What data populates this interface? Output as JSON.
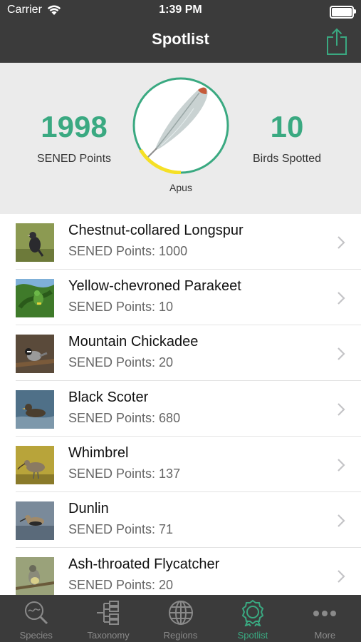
{
  "status_bar": {
    "carrier": "Carrier",
    "time": "1:39 PM"
  },
  "nav": {
    "title": "Spotlist"
  },
  "summary": {
    "points_value": "1998",
    "points_label": "SENED Points",
    "birds_value": "10",
    "birds_label": "Birds Spotted",
    "avatar_label": "Apus",
    "accent_color": "#3aa981"
  },
  "list": {
    "items": [
      {
        "name": "Chestnut-collared Longspur",
        "points": "SENED Points: 1000"
      },
      {
        "name": "Yellow-chevroned Parakeet",
        "points": "SENED Points: 10"
      },
      {
        "name": "Mountain Chickadee",
        "points": "SENED Points: 20"
      },
      {
        "name": "Black Scoter",
        "points": "SENED Points: 680"
      },
      {
        "name": "Whimbrel",
        "points": "SENED Points: 137"
      },
      {
        "name": "Dunlin",
        "points": "SENED Points: 71"
      },
      {
        "name": "Ash-throated Flycatcher",
        "points": "SENED Points: 20"
      }
    ]
  },
  "tabbar": {
    "tabs": [
      {
        "label": "Species",
        "icon": "search-icon"
      },
      {
        "label": "Taxonomy",
        "icon": "tree-icon"
      },
      {
        "label": "Regions",
        "icon": "globe-icon"
      },
      {
        "label": "Spotlist",
        "icon": "award-icon"
      },
      {
        "label": "More",
        "icon": "more-icon"
      }
    ],
    "active": "Spotlist"
  }
}
